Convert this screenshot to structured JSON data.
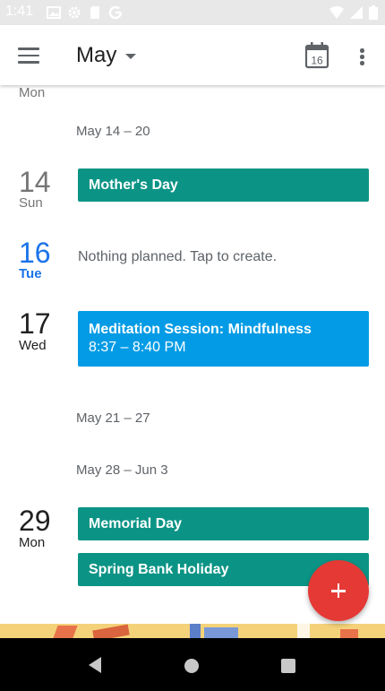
{
  "status_bar": {
    "time": "1:41",
    "icons": [
      "image-icon",
      "gear-icon",
      "sd-card-icon",
      "google-icon",
      "wifi-icon",
      "signal-icon",
      "battery-icon"
    ]
  },
  "app_bar": {
    "menu_icon": "hamburger-menu-icon",
    "month": "May",
    "today_icon_day": "16",
    "overflow_icon": "more-vertical-icon"
  },
  "agenda": {
    "partial_day_name": "Mon",
    "weeks": [
      {
        "label": "May 14 – 20",
        "days": [
          {
            "number": "14",
            "name": "Sun",
            "is_today": false,
            "events": [
              {
                "title": "Mother's Day",
                "time": "",
                "color": "#0b9485"
              }
            ]
          },
          {
            "number": "16",
            "name": "Tue",
            "is_today": true,
            "nothing_planned": "Nothing planned. Tap to create."
          },
          {
            "number": "17",
            "name": "Wed",
            "is_today": false,
            "events": [
              {
                "title": "Meditation Session: Mindfulness",
                "time": "8:37 – 8:40 PM",
                "color": "#039be5"
              }
            ]
          }
        ]
      },
      {
        "label": "May 21 – 27",
        "days": []
      },
      {
        "label": "May 28 – Jun 3",
        "days": [
          {
            "number": "29",
            "name": "Mon",
            "is_today": false,
            "events": [
              {
                "title": "Memorial Day",
                "time": "",
                "color": "#0b9485"
              },
              {
                "title": "Spring Bank Holiday",
                "time": "",
                "color": "#0b9485"
              }
            ]
          }
        ]
      }
    ]
  },
  "fab": {
    "icon": "add-icon",
    "color": "#e53935"
  },
  "nav_bar": {
    "back_icon": "back-icon",
    "home_icon": "home-icon",
    "recents_icon": "recents-icon"
  },
  "colors": {
    "accent": "#1a73e8",
    "event_green": "#0b9485",
    "event_blue": "#039be5"
  }
}
